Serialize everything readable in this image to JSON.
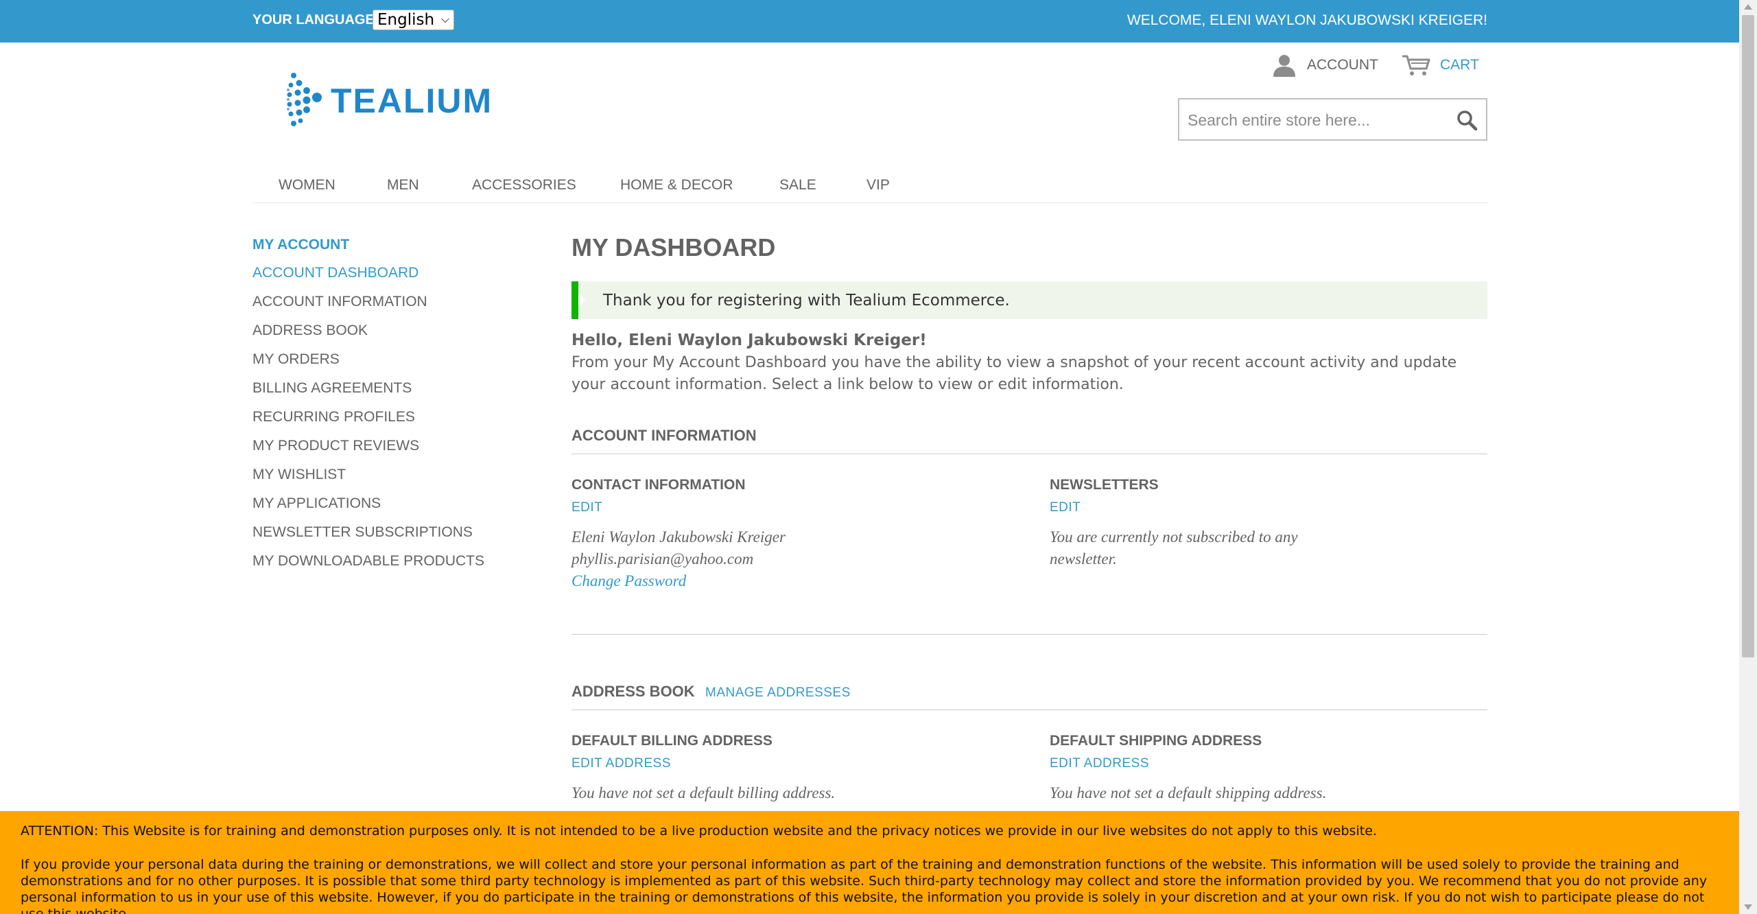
{
  "topbar": {
    "language_label": "YOUR LANGUAGE:",
    "language_value": "English",
    "welcome": "WELCOME, ELENI WAYLON JAKUBOWSKI KREIGER!"
  },
  "header": {
    "logo_text": "TEALIUM",
    "account_label": "ACCOUNT",
    "cart_label": "CART",
    "search_placeholder": "Search entire store here..."
  },
  "nav": {
    "items": [
      "WOMEN",
      "MEN",
      "ACCESSORIES",
      "HOME & DECOR",
      "SALE",
      "VIP"
    ]
  },
  "sidebar": {
    "title": "MY ACCOUNT",
    "items": [
      "ACCOUNT DASHBOARD",
      "ACCOUNT INFORMATION",
      "ADDRESS BOOK",
      "MY ORDERS",
      "BILLING AGREEMENTS",
      "RECURRING PROFILES",
      "MY PRODUCT REVIEWS",
      "MY WISHLIST",
      "MY APPLICATIONS",
      "NEWSLETTER SUBSCRIPTIONS",
      "MY DOWNLOADABLE PRODUCTS"
    ],
    "active_index": 0
  },
  "main": {
    "title": "MY DASHBOARD",
    "success_message": "Thank you for registering with Tealium Ecommerce.",
    "hello": "Hello, Eleni Waylon Jakubowski Kreiger!",
    "intro": "From your My Account Dashboard you have the ability to view a snapshot of your recent account activity and update your account information. Select a link below to view or edit information.",
    "account_info": {
      "title": "ACCOUNT INFORMATION",
      "contact": {
        "title": "CONTACT INFORMATION",
        "edit_label": "EDIT",
        "name": "Eleni Waylon Jakubowski Kreiger",
        "email": "phyllis.parisian@yahoo.com",
        "change_password": "Change Password"
      },
      "newsletters": {
        "title": "NEWSLETTERS",
        "edit_label": "EDIT",
        "text": "You are currently not subscribed to any newsletter."
      }
    },
    "address_book": {
      "title": "ADDRESS BOOK",
      "manage_label": "MANAGE ADDRESSES",
      "billing": {
        "title": "DEFAULT BILLING ADDRESS",
        "edit_label": "EDIT ADDRESS",
        "text": "You have not set a default billing address."
      },
      "shipping": {
        "title": "DEFAULT SHIPPING ADDRESS",
        "edit_label": "EDIT ADDRESS",
        "text": "You have not set a default shipping address."
      }
    }
  },
  "notice": {
    "line1": "ATTENTION: This Website is for training and demonstration purposes only. It is not intended to be a live production website and the privacy notices we provide in our live websites do not apply to this website.",
    "line2": "If you provide your personal data during the training or demonstrations, we will collect and store your personal information as part of the training and demonstration functions of the website. This information will be used solely to provide the training and demonstrations and for no other purposes. It is possible that some third party technology is implemented as part of this website. Such third-party technology may collect and store the information provided by you. We recommend that you do not provide any personal information to us in your use of this website. However, if you do participate in the training or demonstrations of this website, the information you provide is solely in your discretion and at your own risk. If you do not wish to participate please do not use this website."
  },
  "colors": {
    "brand_blue": "#3399cc",
    "success_green": "#11b400",
    "notice_orange": "#ffa500"
  }
}
